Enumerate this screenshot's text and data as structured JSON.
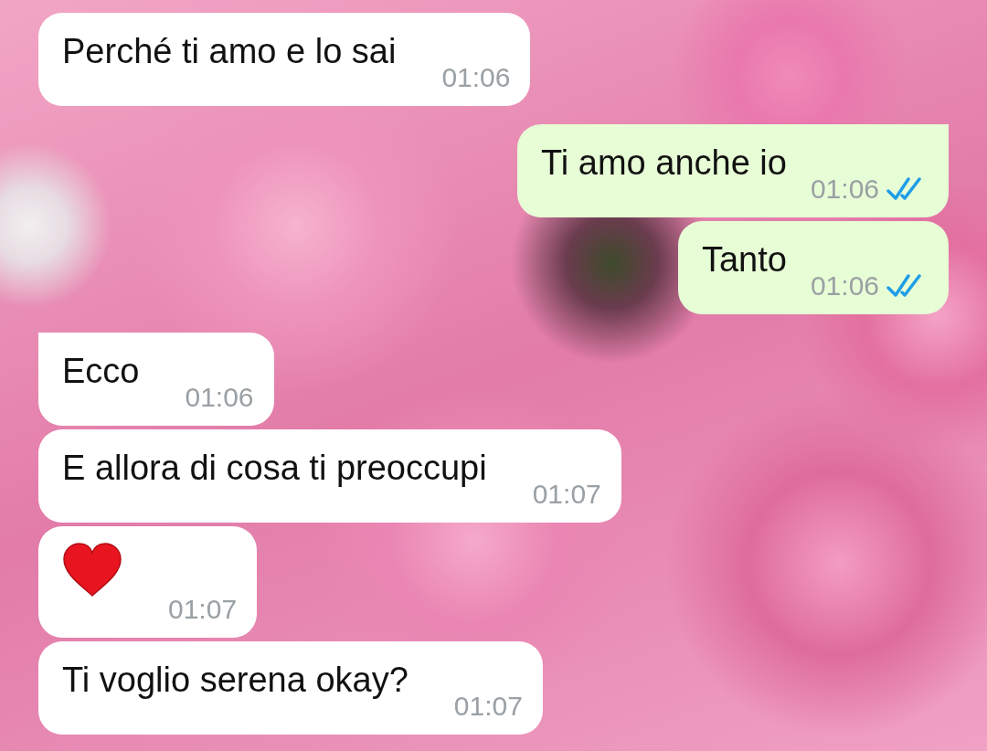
{
  "messages": [
    {
      "kind": "text",
      "outgoing": false,
      "tail": false,
      "text": "Perché ti amo e lo sai",
      "time": "01:06"
    },
    {
      "kind": "text",
      "outgoing": true,
      "tail": true,
      "text": "Ti amo anche io",
      "time": "01:06",
      "read": true
    },
    {
      "kind": "text",
      "outgoing": true,
      "tail": false,
      "text": "Tanto",
      "time": "01:06",
      "read": true
    },
    {
      "kind": "text",
      "outgoing": false,
      "tail": true,
      "text": "Ecco",
      "time": "01:06"
    },
    {
      "kind": "text",
      "outgoing": false,
      "tail": false,
      "text": "E allora di cosa ti preoccupi",
      "time": "01:07"
    },
    {
      "kind": "heart",
      "outgoing": false,
      "tail": false,
      "time": "01:07"
    },
    {
      "kind": "text",
      "outgoing": false,
      "tail": false,
      "text": "Ti voglio serena okay?",
      "time": "01:07"
    }
  ]
}
